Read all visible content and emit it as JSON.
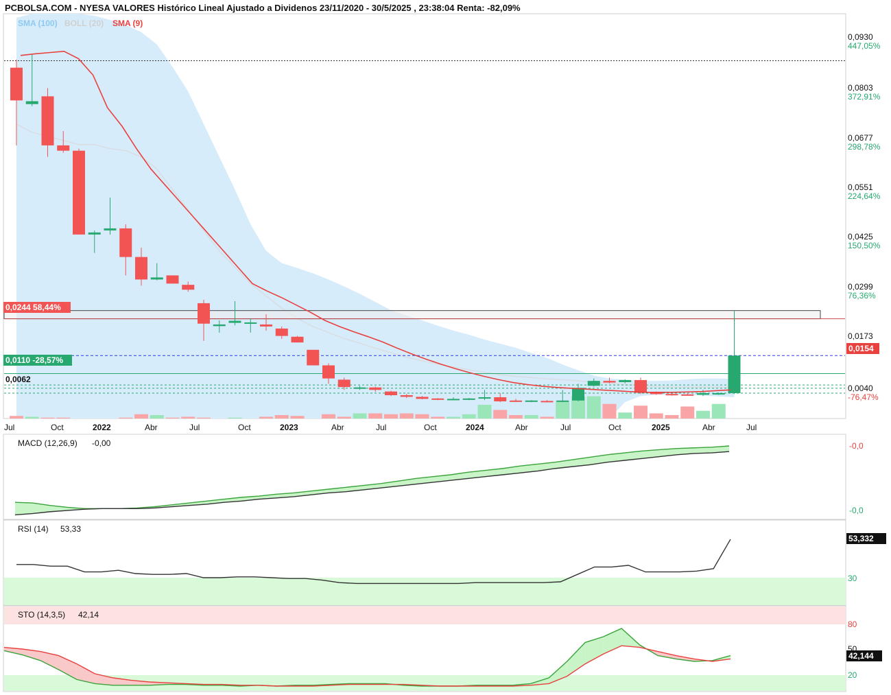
{
  "header": {
    "title": "PCBOLSA.COM - NYESA VALORES Histórico Lineal Ajustado a Dividenos 23/11/2020 - 30/5/2025 , 23:38:04 Renta: -82,09%",
    "legend": {
      "sma100": "SMA (100)",
      "boll": "BOLL (20)",
      "sma9": "SMA (9)"
    }
  },
  "colors": {
    "up": "#26a86e",
    "down": "#f25353",
    "sma9": "#e8413e",
    "band": "#d6ecfb",
    "volUp": "#9be6b8",
    "volDown": "#f9a5a5",
    "macdFill": "#c8f4c8",
    "rsiZone": "#d8fad8",
    "stoUpperZone": "#fde2e2"
  },
  "chart_data": [
    {
      "type": "candlestick",
      "title": "NYESA VALORES",
      "x_labels": [
        "Jul",
        "Oct",
        "2022",
        "Abr",
        "Jul",
        "Oct",
        "2023",
        "Abr",
        "Jul",
        "Oct",
        "2024",
        "Abr",
        "Jul",
        "Oct",
        "2025",
        "Abr",
        "Jul"
      ],
      "y_ticks": [
        {
          "price": "0,0930",
          "pct": "447,05%"
        },
        {
          "price": "0,0803",
          "pct": "372,91%"
        },
        {
          "price": "0,0677",
          "pct": "298,78%"
        },
        {
          "price": "0,0551",
          "pct": "224,64%"
        },
        {
          "price": "0,0425",
          "pct": "150,50%"
        },
        {
          "price": "0,0299",
          "pct": "76,36%"
        },
        {
          "price": "0,0173",
          "pct": ""
        },
        {
          "price": "0,0040",
          "pct": "-76,47%"
        }
      ],
      "ylim": [
        0.0,
        0.099
      ],
      "last_price": "0,0154",
      "markers": [
        {
          "label": "0,0244  58,44%",
          "value": 0.0244
        },
        {
          "label": "0,0110  -28,57%",
          "value": 0.011
        },
        {
          "label": "0,0062",
          "value": 0.0062
        }
      ],
      "candles": [
        {
          "o": 0.0858,
          "h": 0.0878,
          "l": 0.0668,
          "c": 0.0778
        },
        {
          "o": 0.0769,
          "h": 0.089,
          "l": 0.0764,
          "c": 0.0776
        },
        {
          "o": 0.0788,
          "h": 0.0808,
          "l": 0.064,
          "c": 0.0668
        },
        {
          "o": 0.0668,
          "h": 0.0703,
          "l": 0.065,
          "c": 0.0655
        },
        {
          "o": 0.0655,
          "h": 0.066,
          "l": 0.045,
          "c": 0.045
        },
        {
          "o": 0.045,
          "h": 0.046,
          "l": 0.0405,
          "c": 0.0455
        },
        {
          "o": 0.046,
          "h": 0.054,
          "l": 0.045,
          "c": 0.0465
        },
        {
          "o": 0.0465,
          "h": 0.0475,
          "l": 0.035,
          "c": 0.0395
        },
        {
          "o": 0.0395,
          "h": 0.0418,
          "l": 0.0325,
          "c": 0.034
        },
        {
          "o": 0.034,
          "h": 0.038,
          "l": 0.0338,
          "c": 0.0345
        },
        {
          "o": 0.035,
          "h": 0.035,
          "l": 0.033,
          "c": 0.033
        },
        {
          "o": 0.0327,
          "h": 0.0335,
          "l": 0.031,
          "c": 0.0315
        },
        {
          "o": 0.0282,
          "h": 0.029,
          "l": 0.019,
          "c": 0.0232
        },
        {
          "o": 0.0226,
          "h": 0.024,
          "l": 0.021,
          "c": 0.023
        },
        {
          "o": 0.0234,
          "h": 0.0287,
          "l": 0.0228,
          "c": 0.0239
        },
        {
          "o": 0.0235,
          "h": 0.0245,
          "l": 0.021,
          "c": 0.0235
        },
        {
          "o": 0.023,
          "h": 0.0255,
          "l": 0.0215,
          "c": 0.0225
        },
        {
          "o": 0.022,
          "h": 0.0225,
          "l": 0.0195,
          "c": 0.0202
        },
        {
          "o": 0.02,
          "h": 0.0202,
          "l": 0.0186,
          "c": 0.0186
        },
        {
          "o": 0.0168,
          "h": 0.0168,
          "l": 0.013,
          "c": 0.013
        },
        {
          "o": 0.013,
          "h": 0.0135,
          "l": 0.0085,
          "c": 0.0098
        },
        {
          "o": 0.0095,
          "h": 0.01,
          "l": 0.007,
          "c": 0.0077
        },
        {
          "o": 0.0075,
          "h": 0.008,
          "l": 0.007,
          "c": 0.0076
        },
        {
          "o": 0.0076,
          "h": 0.0078,
          "l": 0.0065,
          "c": 0.007
        },
        {
          "o": 0.0066,
          "h": 0.0068,
          "l": 0.0055,
          "c": 0.0057
        },
        {
          "o": 0.0057,
          "h": 0.006,
          "l": 0.005,
          "c": 0.0053
        },
        {
          "o": 0.0053,
          "h": 0.0055,
          "l": 0.0047,
          "c": 0.0048
        },
        {
          "o": 0.0049,
          "h": 0.005,
          "l": 0.0045,
          "c": 0.0047
        },
        {
          "o": 0.0047,
          "h": 0.0052,
          "l": 0.0045,
          "c": 0.0048
        },
        {
          "o": 0.0048,
          "h": 0.005,
          "l": 0.0045,
          "c": 0.0049
        },
        {
          "o": 0.0049,
          "h": 0.007,
          "l": 0.0045,
          "c": 0.0052
        },
        {
          "o": 0.0052,
          "h": 0.0062,
          "l": 0.004,
          "c": 0.0042
        },
        {
          "o": 0.0044,
          "h": 0.0048,
          "l": 0.004,
          "c": 0.0042
        },
        {
          "o": 0.0042,
          "h": 0.0045,
          "l": 0.004,
          "c": 0.0044
        },
        {
          "o": 0.0043,
          "h": 0.0045,
          "l": 0.004,
          "c": 0.0041
        },
        {
          "o": 0.0041,
          "h": 0.007,
          "l": 0.004,
          "c": 0.0044
        },
        {
          "o": 0.0044,
          "h": 0.0085,
          "l": 0.0042,
          "c": 0.0075
        },
        {
          "o": 0.008,
          "h": 0.0098,
          "l": 0.0078,
          "c": 0.0092
        },
        {
          "o": 0.0092,
          "h": 0.01,
          "l": 0.0086,
          "c": 0.0088
        },
        {
          "o": 0.0089,
          "h": 0.0096,
          "l": 0.0086,
          "c": 0.0094
        },
        {
          "o": 0.0094,
          "h": 0.01,
          "l": 0.006,
          "c": 0.0063
        },
        {
          "o": 0.0063,
          "h": 0.0066,
          "l": 0.0058,
          "c": 0.006
        },
        {
          "o": 0.006,
          "h": 0.0064,
          "l": 0.0056,
          "c": 0.0059
        },
        {
          "o": 0.0059,
          "h": 0.0063,
          "l": 0.0056,
          "c": 0.0058
        },
        {
          "o": 0.0058,
          "h": 0.007,
          "l": 0.0055,
          "c": 0.0062
        },
        {
          "o": 0.0062,
          "h": 0.0064,
          "l": 0.0058,
          "c": 0.0062
        },
        {
          "o": 0.0062,
          "h": 0.0264,
          "l": 0.006,
          "c": 0.0154
        }
      ],
      "sma9": [
        0.0888,
        0.0892,
        0.0895,
        0.0898,
        0.088,
        0.084,
        0.076,
        0.0715,
        0.066,
        0.061,
        0.057,
        0.053,
        0.049,
        0.045,
        0.041,
        0.037,
        0.033,
        0.0312,
        0.0296,
        0.0278,
        0.026,
        0.024,
        0.0225,
        0.0212,
        0.02,
        0.0187,
        0.0172,
        0.0158,
        0.0145,
        0.0133,
        0.0122,
        0.0112,
        0.0103,
        0.0095,
        0.0088,
        0.0083,
        0.0079,
        0.0076,
        0.0074,
        0.0072,
        0.007,
        0.0068,
        0.0066,
        0.0064,
        0.0064,
        0.0064,
        0.0065,
        0.0066,
        0.0068,
        0.007
      ],
      "sma9_dates_note": "",
      "boll_mid": [
        0.072,
        0.07,
        0.069,
        0.068,
        0.067,
        0.067,
        0.066,
        0.0655,
        0.064,
        0.061,
        0.056,
        0.051,
        0.046,
        0.041,
        0.037,
        0.033,
        0.03,
        0.027,
        0.0245,
        0.0225,
        0.021,
        0.0196,
        0.0184,
        0.0172,
        0.0161,
        0.015,
        0.0141,
        0.0133,
        0.0126,
        0.0119,
        0.0113,
        0.0107,
        0.0103,
        0.01,
        0.0097,
        0.0095,
        0.0092,
        0.0089,
        0.0086,
        0.0083,
        0.008,
        0.0078,
        0.0077,
        0.0077,
        0.0077,
        0.0077,
        0.0076
      ],
      "boll_upper": [
        0.098,
        0.099,
        0.099,
        0.099,
        0.099,
        0.0985,
        0.0975,
        0.0962,
        0.0945,
        0.0915,
        0.086,
        0.08,
        0.072,
        0.064,
        0.056,
        0.0475,
        0.041,
        0.038,
        0.0368,
        0.0355,
        0.034,
        0.0323,
        0.0305,
        0.0285,
        0.0265,
        0.0252,
        0.024,
        0.0227,
        0.0215,
        0.0205,
        0.0193,
        0.0183,
        0.0173,
        0.016,
        0.0148,
        0.0132,
        0.0118,
        0.0105,
        0.0098,
        0.0095,
        0.0092,
        0.0092,
        0.0093,
        0.0096,
        0.0098,
        0.0098,
        0.0097
      ],
      "boll_lower": [
        0.0,
        0.0,
        0.0,
        0.0,
        0.0,
        0.0,
        0.0,
        0.0,
        0.0,
        0.0,
        0.0,
        0.0,
        0.0,
        0.0,
        0.0,
        0.0,
        0.0,
        0.0,
        0.0,
        0.0,
        0.0,
        0.0,
        0.0,
        0.0,
        0.0,
        0.0,
        0.0,
        0.0,
        0.0,
        0.0,
        0.0,
        0.0,
        0.0,
        0.0,
        0.0,
        0.0,
        0.0,
        0.0,
        0.0,
        0.004,
        0.0055,
        0.0058,
        0.0058,
        0.0058,
        0.0056,
        0.0054,
        0.0052
      ],
      "volume": [
        0.3,
        0.2,
        0.1,
        0.1,
        0.0,
        0.0,
        0.0,
        0.1,
        0.5,
        0.4,
        0.1,
        0.2,
        0.1,
        0.0,
        0.1,
        0.0,
        0.2,
        0.4,
        0.3,
        0.0,
        0.5,
        0.2,
        0.6,
        0.6,
        0.5,
        0.6,
        0.5,
        0.2,
        0.2,
        0.5,
        1.6,
        1.0,
        0.4,
        0.4,
        0.2,
        2.0,
        2.6,
        2.6,
        1.7,
        0.7,
        1.5,
        0.6,
        0.4,
        1.4,
        0.9,
        1.7
      ]
    },
    {
      "type": "line",
      "title": "MACD (12,26,9)",
      "value_label": "-0,00",
      "y_ticks": [
        "-0,0",
        "-0,0"
      ],
      "macd": [
        0.1,
        0.09,
        0.05,
        0.02,
        0.0,
        0.0,
        0.0,
        0.01,
        0.03,
        0.06,
        0.09,
        0.12,
        0.15,
        0.18,
        0.2,
        0.23,
        0.25,
        0.28,
        0.31,
        0.34,
        0.37,
        0.4,
        0.44,
        0.48,
        0.51,
        0.54,
        0.58,
        0.61,
        0.64,
        0.68,
        0.71,
        0.74,
        0.78,
        0.82,
        0.86,
        0.89,
        0.92,
        0.94,
        0.96,
        0.97,
        0.98,
        1.0
      ],
      "signal": [
        -0.1,
        -0.08,
        -0.05,
        -0.03,
        -0.01,
        0.0,
        0.0,
        0.0,
        0.01,
        0.03,
        0.05,
        0.07,
        0.1,
        0.12,
        0.15,
        0.17,
        0.19,
        0.22,
        0.25,
        0.27,
        0.3,
        0.33,
        0.36,
        0.39,
        0.42,
        0.45,
        0.48,
        0.51,
        0.54,
        0.57,
        0.6,
        0.64,
        0.67,
        0.7,
        0.74,
        0.77,
        0.8,
        0.83,
        0.86,
        0.88,
        0.89,
        0.91
      ]
    },
    {
      "type": "line",
      "title": "RSI (14)",
      "value_label": "53,33",
      "last_value": "53,332",
      "y_ticks": [
        "30"
      ],
      "series": [
        38.0,
        38.0,
        37.0,
        37.0,
        33.5,
        33.5,
        34.5,
        32.5,
        32.0,
        32.0,
        32.5,
        30.0,
        30.0,
        30.5,
        30.5,
        30.0,
        29.5,
        29.5,
        28.5,
        27.0,
        26.5,
        26.5,
        26.5,
        26.5,
        26.5,
        26.5,
        26.5,
        27.0,
        27.0,
        27.0,
        27.0,
        27.0,
        27.5,
        32.0,
        36.5,
        36.5,
        37.5,
        33.5,
        33.5,
        33.5,
        34.0,
        35.5,
        53.3
      ]
    },
    {
      "type": "line",
      "title": "STO (14,3,5)",
      "value_label": "42,14",
      "last_value": "42,144",
      "y_ticks": [
        "80",
        "50",
        "20"
      ],
      "k": [
        48,
        43,
        36,
        25,
        13,
        8,
        6,
        6,
        6,
        7,
        7,
        6,
        6,
        5,
        6,
        5,
        6,
        6,
        7,
        8,
        8,
        8,
        6,
        5,
        5,
        5,
        6,
        6,
        6,
        8,
        15,
        35,
        58,
        65,
        75,
        55,
        42,
        38,
        35,
        36,
        42
      ],
      "d": [
        52,
        50,
        47,
        42,
        32,
        20,
        15,
        12,
        10,
        9,
        8,
        7,
        7,
        6,
        6,
        5,
        5,
        5,
        6,
        7,
        7,
        7,
        7,
        6,
        5,
        5,
        5,
        5,
        5,
        6,
        8,
        17,
        32,
        44,
        54,
        52,
        47,
        42,
        38,
        35,
        38
      ]
    }
  ]
}
